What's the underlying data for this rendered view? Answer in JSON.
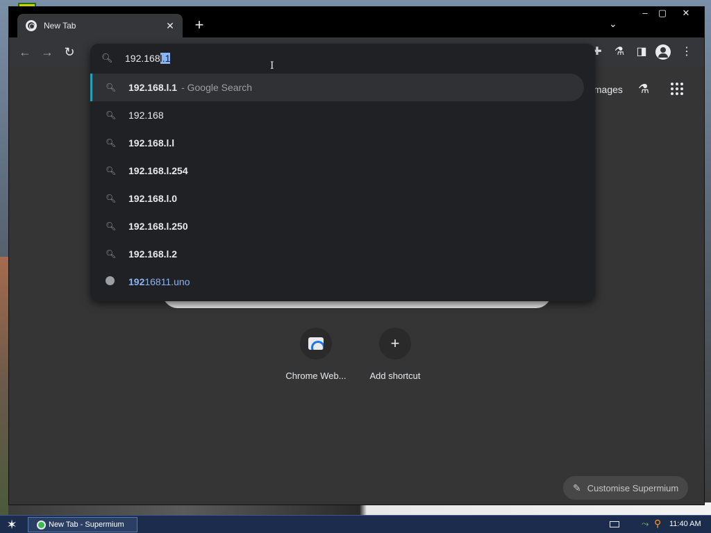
{
  "window": {
    "tab_title": "New Tab",
    "tab_close": "✕",
    "new_tab": "+",
    "tab_search": "⌄",
    "minimize": "–",
    "maximize": "▢",
    "close": "✕"
  },
  "toolbar": {
    "back": "←",
    "forward": "→",
    "reload": "↻",
    "extensions": "✚",
    "labs": "⚗",
    "side_panel": "◨",
    "menu": "⋮"
  },
  "omnibox": {
    "typed_text": "192.168",
    "selected_completion": "l.1",
    "suggestions": [
      {
        "main": "192.168.l.1",
        "desc": "- Google Search",
        "type": "search"
      },
      {
        "main": "192.168",
        "type": "search"
      },
      {
        "main": "192.168.l.l",
        "type": "search"
      },
      {
        "main": "192.168.l.254",
        "type": "search"
      },
      {
        "main": "192.168.l.0",
        "type": "search"
      },
      {
        "main": "192.168.l.250",
        "type": "search"
      },
      {
        "main": "192.168.l.2",
        "type": "search"
      },
      {
        "match": "192",
        "rest": "16811.uno",
        "type": "url"
      }
    ]
  },
  "ntp": {
    "images_link": "Images",
    "shortcuts": [
      {
        "label": "Chrome Web..."
      },
      {
        "label": "Add shortcut",
        "icon": "+"
      }
    ],
    "customise": "Customise Supermium"
  },
  "taskbar": {
    "task_label": "New Tab - Supermium",
    "clock": "11:40 AM"
  },
  "colors": {
    "accent": "#8ab4f8",
    "selected_bar": "#24a0bc",
    "page_bg": "#353535",
    "popup_bg": "#202124"
  }
}
